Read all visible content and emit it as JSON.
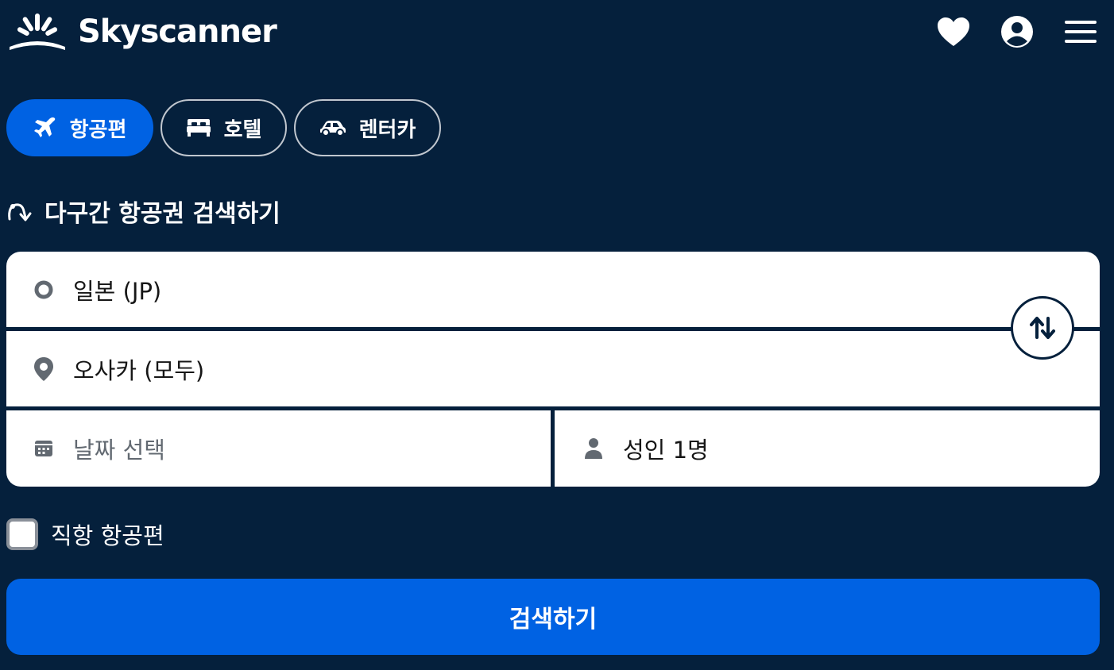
{
  "brand": {
    "name": "Skyscanner"
  },
  "header": {
    "icons": [
      "heart-icon",
      "account-icon",
      "menu-icon"
    ]
  },
  "tabs": [
    {
      "label": "항공편",
      "icon": "plane-icon",
      "active": true
    },
    {
      "label": "호텔",
      "icon": "bed-icon",
      "active": false
    },
    {
      "label": "렌터카",
      "icon": "car-icon",
      "active": false
    }
  ],
  "multi_city": {
    "label": "다구간 항공권 검색하기"
  },
  "form": {
    "origin": "일본 (JP)",
    "destination": "오사카 (모두)",
    "date_placeholder": "날짜 선택",
    "travellers": "성인 1명"
  },
  "direct_flights": {
    "label": "직항 항공편",
    "checked": false
  },
  "search_button": {
    "label": "검색하기"
  },
  "colors": {
    "background": "#05203c",
    "accent": "#0062e3",
    "field": "#ffffff",
    "text_dark": "#161616",
    "placeholder": "#626971"
  }
}
